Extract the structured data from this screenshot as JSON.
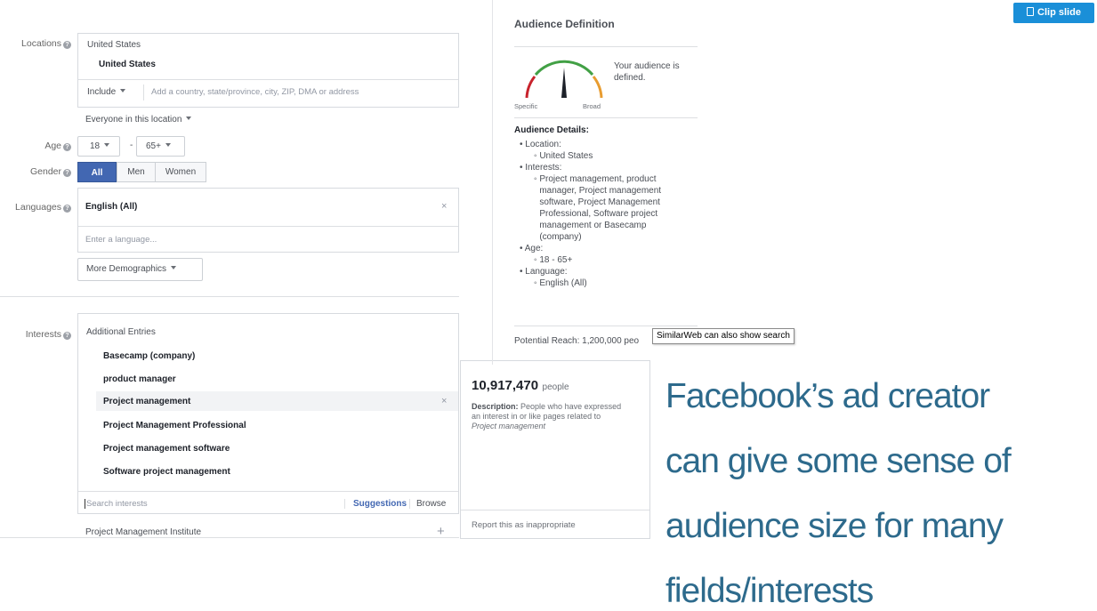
{
  "clip_button": {
    "label": "Clip slide",
    "color": "#1a8fd8"
  },
  "form": {
    "locations": {
      "label": "Locations",
      "header": "United States",
      "selected": "United States",
      "include_label": "Include",
      "placeholder": "Add a country, state/province, city, ZIP, DMA or address",
      "scope": "Everyone in this location"
    },
    "age": {
      "label": "Age",
      "min": "18",
      "separator": "-",
      "max": "65+"
    },
    "gender": {
      "label": "Gender",
      "options": [
        "All",
        "Men",
        "Women"
      ],
      "selected": "All"
    },
    "languages": {
      "label": "Languages",
      "selected": "English (All)",
      "placeholder": "Enter a language..."
    },
    "more_demographics": "More Demographics",
    "interests": {
      "label": "Interests",
      "group_title": "Additional Entries",
      "items": [
        "Basecamp (company)",
        "product manager",
        "Project management",
        "Project Management Professional",
        "Project management software",
        "Software project management"
      ],
      "search_placeholder": "Search interests",
      "suggestions_label": "Suggestions",
      "browse_label": "Browse",
      "suggestion": "Project Management Institute"
    }
  },
  "tooltip": {
    "count": "10,917,470",
    "unit": "people",
    "desc_label": "Description:",
    "desc_text": "People who have expressed an interest in or like pages related to",
    "desc_italic": "Project management",
    "report": "Report this as inappropriate"
  },
  "audience": {
    "title": "Audience Definition",
    "status": "Your audience is defined.",
    "gauge_specific": "Specific",
    "gauge_broad": "Broad",
    "details_title": "Audience Details:",
    "location_label": "Location:",
    "location_value": "United States",
    "interests_label": "Interests:",
    "interests_value": "Project management, product manager, Project management software, Project Management Professional, Software project management or Basecamp (company)",
    "age_label": "Age:",
    "age_value": "18 - 65+",
    "language_label": "Language:",
    "language_value": "English (All)",
    "reach_prefix": "Potential Reach: 1,200,000 peo"
  },
  "hover_tooltip": "SimilarWeb can also show search",
  "caption": {
    "lines": [
      "Facebook’s ad creator",
      "can give some sense of",
      "audience size for many",
      "fields/interests"
    ],
    "color": "#2d6a8c"
  }
}
